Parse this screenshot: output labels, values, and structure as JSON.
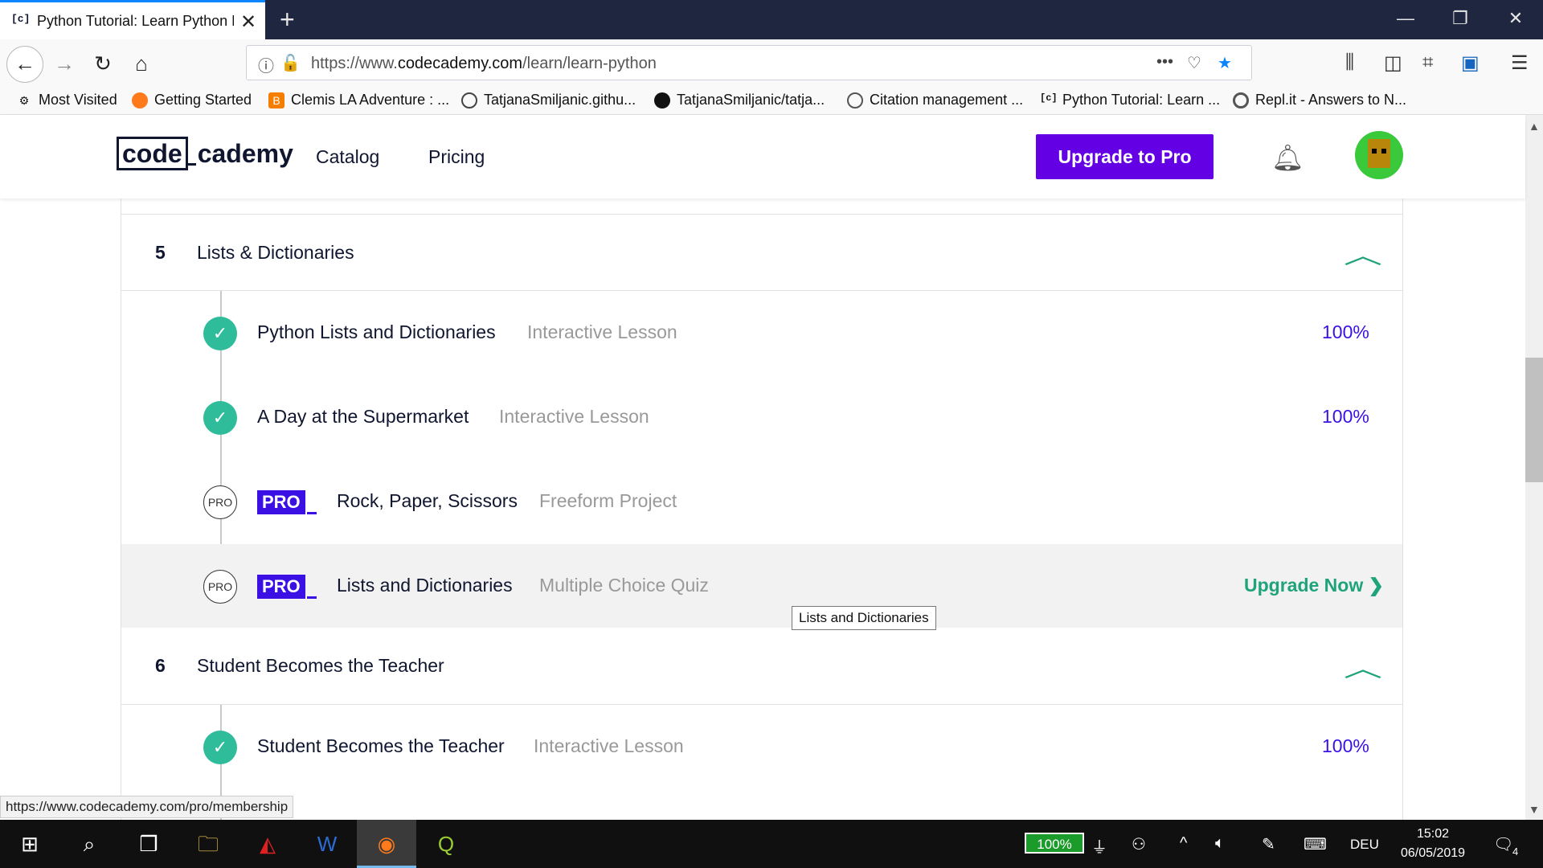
{
  "browser": {
    "tab_title": "Python Tutorial: Learn Python F",
    "tab_favicon": "c̲",
    "url_prefix": "https://www.",
    "url_domain": "codecademy.com",
    "url_path": "/learn/learn-python",
    "bookmarks": [
      {
        "label": "Most Visited",
        "icon": "gear-icon"
      },
      {
        "label": "Getting Started",
        "icon": "firefox-icon"
      },
      {
        "label": "Clemis LA Adventure : ...",
        "icon": "blogger-icon"
      },
      {
        "label": "TatjanaSmiljanic.githu...",
        "icon": "globe-icon"
      },
      {
        "label": "TatjanaSmiljanic/tatja...",
        "icon": "github-icon"
      },
      {
        "label": "Citation management ...",
        "icon": "seal-icon"
      },
      {
        "label": "Python Tutorial: Learn ...",
        "icon": "codecademy-icon"
      },
      {
        "label": "Repl.it - Answers to N...",
        "icon": "replit-icon"
      }
    ]
  },
  "header": {
    "logo_a": "code",
    "logo_b": "cademy",
    "nav": [
      "Catalog",
      "Pricing"
    ],
    "upgrade_label": "Upgrade to Pro"
  },
  "sections": [
    {
      "number": "5",
      "title": "Lists & Dictionaries",
      "lessons": [
        {
          "status": "done",
          "title": "Python Lists and Dictionaries",
          "type": "Interactive Lesson",
          "progress": "100%"
        },
        {
          "status": "done",
          "title": "A Day at the Supermarket",
          "type": "Interactive Lesson",
          "progress": "100%"
        },
        {
          "status": "pro",
          "badge": "PRO",
          "icon_label": "PRO",
          "title": "Rock, Paper, Scissors",
          "type": "Freeform Project"
        },
        {
          "status": "pro",
          "badge": "PRO",
          "icon_label": "PRO",
          "title": "Lists and Dictionaries",
          "type": "Multiple Choice Quiz",
          "action": "Upgrade Now",
          "action_arrow": "❯"
        }
      ]
    },
    {
      "number": "6",
      "title": "Student Becomes the Teacher",
      "lessons": [
        {
          "status": "done",
          "title": "Student Becomes the Teacher",
          "type": "Interactive Lesson",
          "progress": "100%"
        }
      ]
    }
  ],
  "tooltip": "Lists and Dictionaries",
  "status_url": "https://www.codecademy.com/pro/membership",
  "taskbar": {
    "battery": "100%",
    "lang": "DEU",
    "time": "15:02",
    "date": "06/05/2019",
    "notifications": "4"
  },
  "colors": {
    "accent_purple": "#6400e4",
    "pro_blue": "#3a10e5",
    "success_green": "#2ebc9b",
    "link_green": "#1fa37a"
  }
}
